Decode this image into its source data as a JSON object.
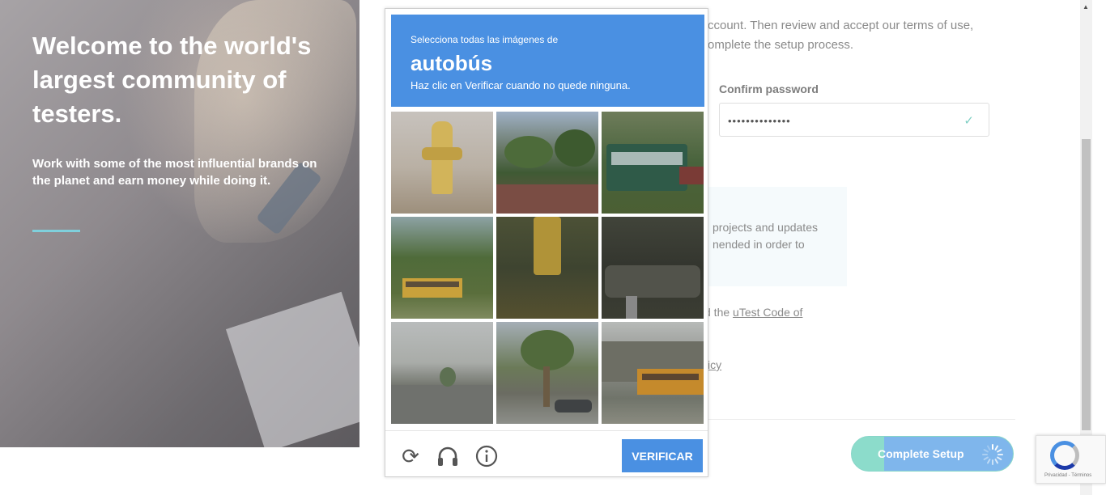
{
  "hero": {
    "title": "Welcome to the world's largest community of testers.",
    "subtitle": "Work with some of the most influential brands on the planet and earn money while doing it."
  },
  "form": {
    "intro_fragment": "ccount. Then review and accept our terms of use, omplete the setup process.",
    "confirm_password_label": "Confirm password",
    "confirm_password_value": "••••••••••••••",
    "info_fragment": "projects and updates nended in order to",
    "coc_prefix": "d the ",
    "coc_link": "uTest Code of",
    "icy_fragment": "icy",
    "complete_button": "Complete Setup"
  },
  "captcha": {
    "line1": "Selecciona todas las imágenes de",
    "target": "autobús",
    "line3": "Haz clic en Verificar cuando no quede ninguna.",
    "verify_button": "VERIFICAR",
    "icons": [
      "reload-icon",
      "audio-icon",
      "info-icon"
    ],
    "tiles": [
      {
        "name": "tile-hydrant"
      },
      {
        "name": "tile-palms"
      },
      {
        "name": "tile-green-bus"
      },
      {
        "name": "tile-school-bus-trees"
      },
      {
        "name": "tile-hydrant-dark"
      },
      {
        "name": "tile-dark-shadow"
      },
      {
        "name": "tile-road"
      },
      {
        "name": "tile-palm-street"
      },
      {
        "name": "tile-school-bus-building"
      }
    ]
  },
  "badge": {
    "text": "Privacidad - Términos"
  },
  "colors": {
    "accent": "#4a90e2",
    "teal": "#7fd0dc",
    "complete_green": "#8cdccb"
  }
}
